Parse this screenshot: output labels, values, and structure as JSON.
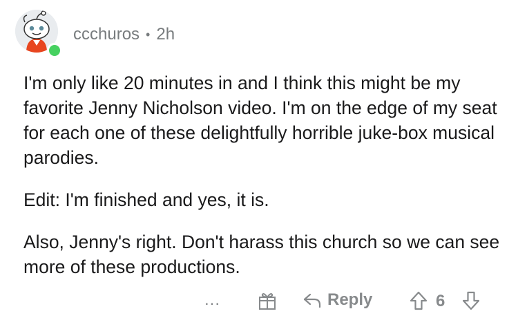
{
  "comment": {
    "username": "ccchuros",
    "separator": "•",
    "time": "2h",
    "paragraphs": [
      "I'm only like 20 minutes in and I think this might be my favorite Jenny Nicholson video.  I'm on the edge of my seat for each one of these delightfully horrible juke-box musical parodies.",
      "Edit:  I'm finished and yes, it is.",
      "Also, Jenny's right.  Don't harass this church so we can see more of these productions."
    ]
  },
  "actions": {
    "more_label": "...",
    "reply_label": "Reply",
    "score": "6"
  },
  "icons": {
    "online": "online-dot",
    "award": "gift-icon",
    "reply": "reply-arrow-icon",
    "upvote": "upvote-arrow-icon",
    "downvote": "downvote-arrow-icon"
  },
  "colors": {
    "online": "#46d160",
    "meta": "#787c7e",
    "text": "#1a1a1b",
    "action": "#878a8c"
  }
}
